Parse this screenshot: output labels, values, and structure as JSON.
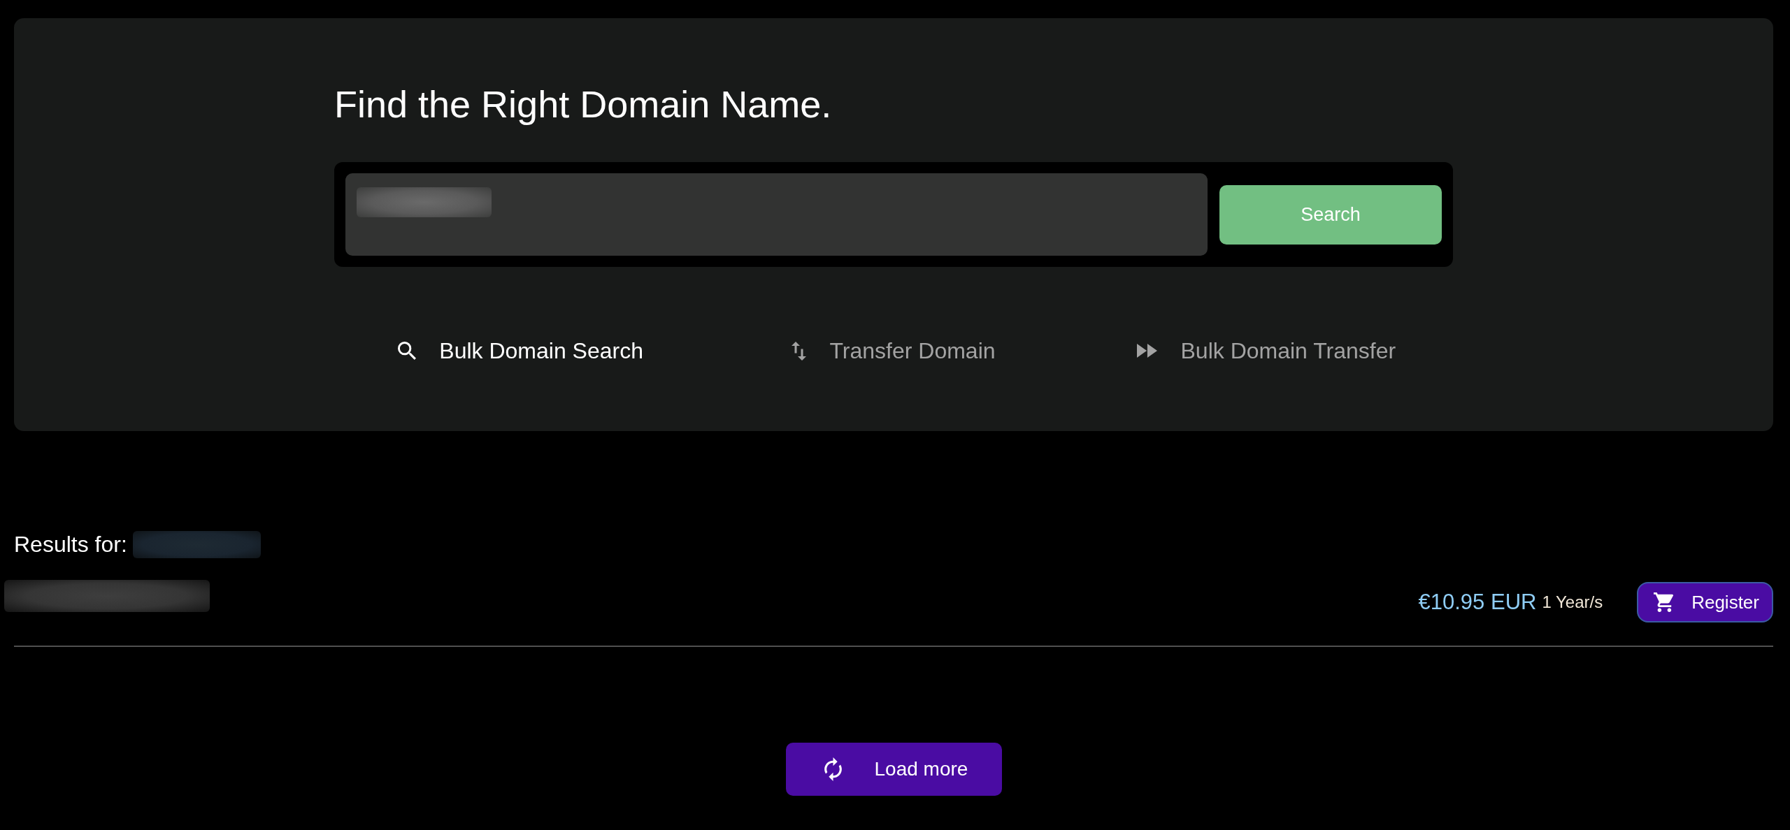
{
  "search_panel": {
    "title": "Find the Right Domain Name.",
    "search_field": {
      "value_blurred": true
    },
    "search_button": "Search",
    "tabs": [
      {
        "kind": "search",
        "label": "Bulk Domain Search",
        "selected": true
      },
      {
        "kind": "transfer",
        "label": "Transfer Domain",
        "selected": false
      },
      {
        "kind": "bulk_transfer",
        "label": "Bulk Domain Transfer",
        "selected": false
      }
    ]
  },
  "results": {
    "label": "Results for:",
    "query_blurred": true,
    "rows": [
      {
        "name_blurred": true,
        "price": "€10.95 EUR",
        "period": "1 Year/s",
        "button": "Register"
      }
    ]
  },
  "load_more": "Load more"
}
